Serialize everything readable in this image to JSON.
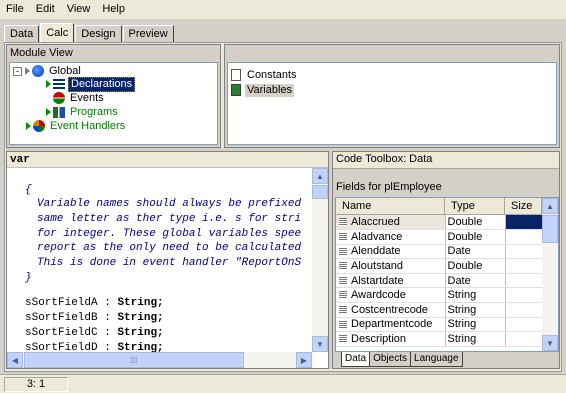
{
  "menubar": [
    "File",
    "Edit",
    "View",
    "Help"
  ],
  "tabs": [
    "Data",
    "Calc",
    "Design",
    "Preview"
  ],
  "active_tab": "Calc",
  "module_view": {
    "title": "Module View",
    "tree": {
      "global": "Global",
      "declarations": "Declarations",
      "events": "Events",
      "programs": "Programs",
      "event_handlers": "Event Handlers"
    }
  },
  "right_list": {
    "constants": "Constants",
    "variables": "Variables"
  },
  "code": {
    "keyword": "var",
    "open_brace": "{",
    "comment_lines": [
      "Variable names should always be prefixed",
      "same letter as ther type i.e. s for stri",
      "for integer. These global variables spee",
      "report as the only need to be calculated",
      "This is done in event handler \"ReportOnS"
    ],
    "close_brace": "}",
    "decls": [
      {
        "name": "sSortFieldA",
        "type": "String;"
      },
      {
        "name": "sSortFieldB",
        "type": "String;"
      },
      {
        "name": "sSortFieldC",
        "type": "String;"
      },
      {
        "name": "sSortFieldD",
        "type": "String;"
      }
    ]
  },
  "toolbox": {
    "title": "Code Toolbox: Data",
    "fields_for": "Fields for plEmployee",
    "columns": [
      "Name",
      "Type",
      "Size"
    ],
    "rows": [
      {
        "name": "Alaccrued",
        "type": "Double"
      },
      {
        "name": "Aladvance",
        "type": "Double"
      },
      {
        "name": "Alenddate",
        "type": "Date"
      },
      {
        "name": "Aloutstand",
        "type": "Double"
      },
      {
        "name": "Alstartdate",
        "type": "Date"
      },
      {
        "name": "Awardcode",
        "type": "String"
      },
      {
        "name": "Costcentrecode",
        "type": "String"
      },
      {
        "name": "Departmentcode",
        "type": "String"
      },
      {
        "name": "Description",
        "type": "String"
      }
    ],
    "bottom_tabs": [
      "Data",
      "Objects",
      "Language"
    ]
  },
  "status": {
    "position": "3: 1"
  }
}
